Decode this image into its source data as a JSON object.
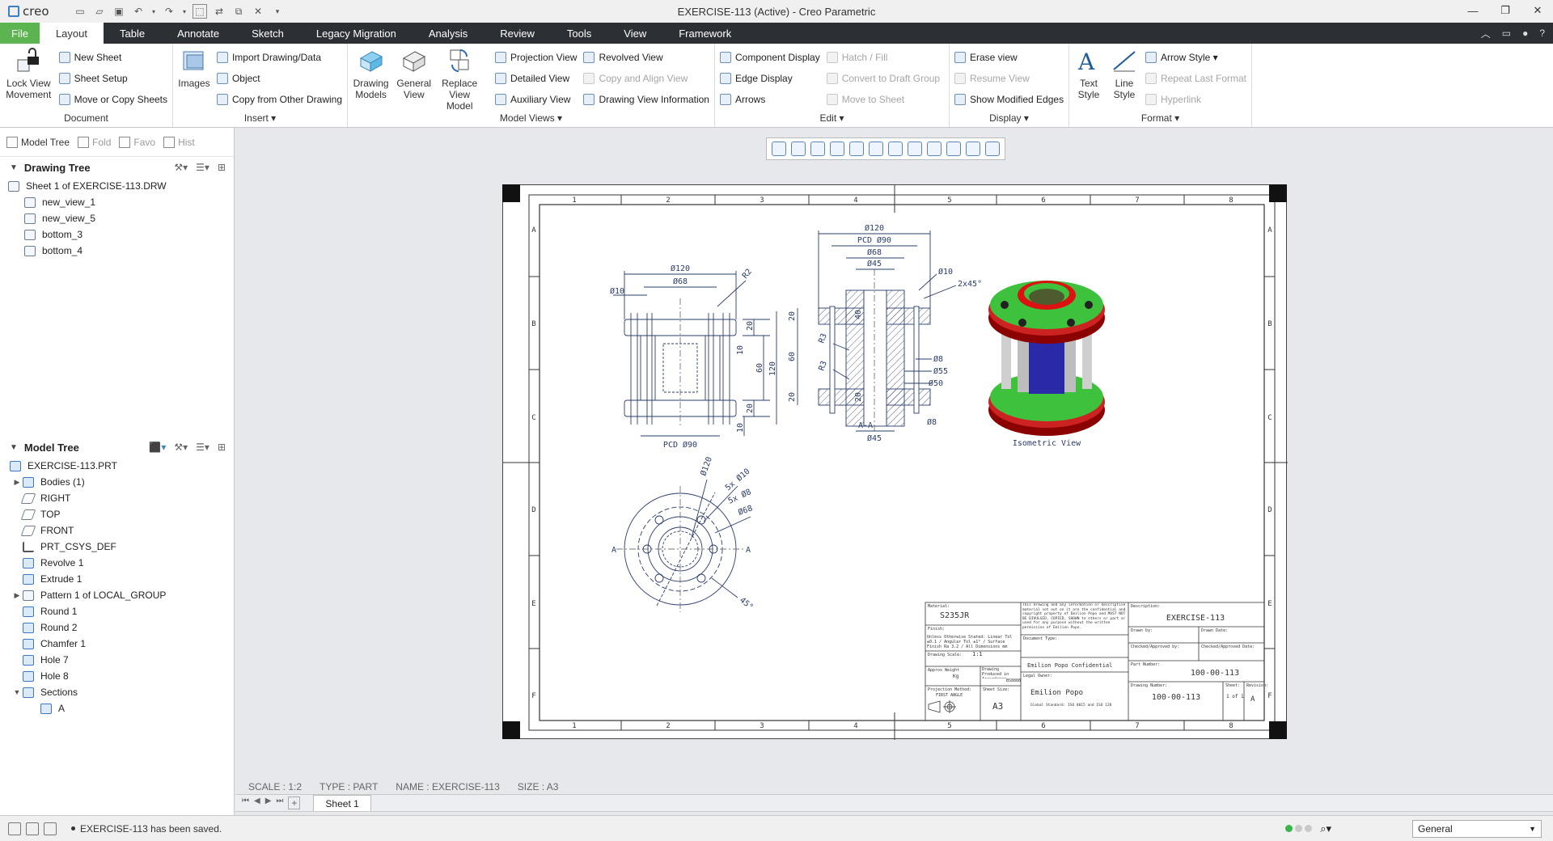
{
  "app": {
    "title": "EXERCISE-113 (Active) - Creo Parametric",
    "logo": "creo"
  },
  "tabs": [
    {
      "label": "File"
    },
    {
      "label": "Layout"
    },
    {
      "label": "Table"
    },
    {
      "label": "Annotate"
    },
    {
      "label": "Sketch"
    },
    {
      "label": "Legacy Migration"
    },
    {
      "label": "Analysis"
    },
    {
      "label": "Review"
    },
    {
      "label": "Tools"
    },
    {
      "label": "View"
    },
    {
      "label": "Framework"
    }
  ],
  "ribbon": {
    "document": {
      "label": "Document",
      "lock_view": "Lock View Movement",
      "new_sheet": "New Sheet",
      "sheet_setup": "Sheet Setup",
      "move_copy": "Move or Copy Sheets"
    },
    "insert": {
      "label": "Insert",
      "images": "Images",
      "import": "Import Drawing/Data",
      "object": "Object",
      "copy_other": "Copy from Other Drawing"
    },
    "model_views": {
      "label": "Model Views",
      "drawing_models": "Drawing Models",
      "general_view": "General View",
      "replace_model": "Replace View Model",
      "projection": "Projection View",
      "detailed": "Detailed View",
      "auxiliary": "Auxiliary View",
      "revolved": "Revolved View",
      "copy_align": "Copy and Align View",
      "view_info": "Drawing View Information"
    },
    "edit": {
      "label": "Edit",
      "component_display": "Component Display",
      "edge_display": "Edge Display",
      "arrows": "Arrows",
      "hatch_fill": "Hatch / Fill",
      "convert_draft": "Convert to Draft Group",
      "move_sheet": "Move to Sheet"
    },
    "display": {
      "label": "Display",
      "erase_view": "Erase view",
      "resume_view": "Resume View",
      "show_modified": "Show Modified Edges"
    },
    "format": {
      "label": "Format",
      "text_style": "Text Style",
      "line_style": "Line Style",
      "arrow_style": "Arrow Style",
      "repeat_last": "Repeat Last Format",
      "hyperlink": "Hyperlink"
    }
  },
  "navtabs": {
    "model_tree": "Model Tree",
    "folder": "Fold",
    "favorites": "Favo",
    "history": "Hist"
  },
  "drawing_tree": {
    "title": "Drawing Tree",
    "items": [
      {
        "label": "Sheet 1 of EXERCISE-113.DRW"
      },
      {
        "label": "new_view_1"
      },
      {
        "label": "new_view_5"
      },
      {
        "label": "bottom_3"
      },
      {
        "label": "bottom_4"
      }
    ]
  },
  "model_tree": {
    "title": "Model Tree",
    "items": [
      {
        "label": "EXERCISE-113.PRT"
      },
      {
        "label": "Bodies (1)"
      },
      {
        "label": "RIGHT"
      },
      {
        "label": "TOP"
      },
      {
        "label": "FRONT"
      },
      {
        "label": "PRT_CSYS_DEF"
      },
      {
        "label": "Revolve 1"
      },
      {
        "label": "Extrude 1"
      },
      {
        "label": "Pattern 1 of LOCAL_GROUP"
      },
      {
        "label": "Round 1"
      },
      {
        "label": "Round 2"
      },
      {
        "label": "Chamfer 1"
      },
      {
        "label": "Hole 7"
      },
      {
        "label": "Hole 8"
      },
      {
        "label": "Sections"
      },
      {
        "label": "A"
      }
    ]
  },
  "drawing": {
    "col_numbers": [
      "1",
      "2",
      "3",
      "4",
      "5",
      "6",
      "7",
      "8"
    ],
    "row_letters": [
      "A",
      "B",
      "C",
      "D",
      "E",
      "F"
    ],
    "front_view": {
      "dim_120": "Ø120",
      "dim_68": "Ø68",
      "dim_10": "Ø10",
      "dim_r2": "R2",
      "dim_20a": "20",
      "dim_10b": "10",
      "dim_60": "60",
      "dim_120v": "120",
      "dim_20b": "20",
      "dim_10c": "10",
      "pcd": "PCD Ø90"
    },
    "section_view": {
      "dim_120": "Ø120",
      "pcd": "PCD Ø90",
      "dim_68": "Ø68",
      "dim_45": "Ø45",
      "dim_10": "Ø10",
      "chamfer": "2x45°",
      "dim_r3a": "R3",
      "dim_r3b": "R3",
      "dim_20a": "20",
      "dim_60": "60",
      "dim_20b": "20",
      "dim_40": "40",
      "dim_20c": "20",
      "dim_8a": "Ø8",
      "dim_55": "Ø55",
      "dim_50": "Ø50",
      "dim_8b": "Ø8",
      "section_label": "A-A",
      "dim_45b": "Ø45"
    },
    "top_view": {
      "dim_120": "Ø120",
      "holes_10": "5x Ø10",
      "holes_8": "5x Ø8",
      "dim_68": "Ø68",
      "angle": "45°",
      "cut_a1": "A",
      "cut_a2": "A"
    },
    "iso_label": "Isometric View",
    "title_block": {
      "material_label": "Material:",
      "material": "S235JR",
      "finish_label": "Finish:",
      "tolerance": "Unless Otherwise Stated: Linear Tol ±0.1 / Angular Tol ±1° / Surface Finish Ra 3.2 / All Dimensions mm",
      "drawing_scale_label": "Drawing Scale:",
      "scale": "1:1",
      "weight_label": "Approx Weight",
      "weight": "Kg",
      "produced_label": "Drawing Produced in Accordance With:",
      "standard": "BS8888",
      "projection_label": "Projection Method:",
      "projection": "FIRST ANGLE",
      "sheet_size_label": "Sheet Size:",
      "sheet_size": "A3",
      "confidential": "This drawing and any information or descriptive material set out on it are the confidential and copyright property of Emilion Popo and MUST NOT BE DIVULGED, COPIED, SHOWN to others or part or used for any purpose without the written permission of Emilion Popo.",
      "doc_type_label": "Document Type:",
      "confidential_short": "Emilion Popo Confidential",
      "legal_owner_label": "Legal Owner:",
      "owner": "Emilion Popo",
      "owner_note": "Global Standard: ISO 8015 and ISO 128",
      "description_label": "Description:",
      "description": "EXERCISE-113",
      "drawn_by_label": "Drawn by:",
      "drawn_date_label": "Drawn Date:",
      "checked_label": "Checked/Approved by:",
      "checked_date_label": "Checked/Approved Date:",
      "part_number_label": "Part Number:",
      "part_number": "100-00-113",
      "drawing_number_label": "Drawing Number:",
      "drawing_number": "100-00-113",
      "sheet_label": "Sheet:",
      "sheet": "1 of 1",
      "revision_label": "Revision:",
      "revision": "A"
    }
  },
  "info": {
    "scale": "SCALE : 1:2",
    "type": "TYPE : PART",
    "name": "NAME : EXERCISE-113",
    "size": "SIZE : A3"
  },
  "sheet_tab": "Sheet 1",
  "status": {
    "message": "EXERCISE-113 has been saved.",
    "filter": "General"
  }
}
